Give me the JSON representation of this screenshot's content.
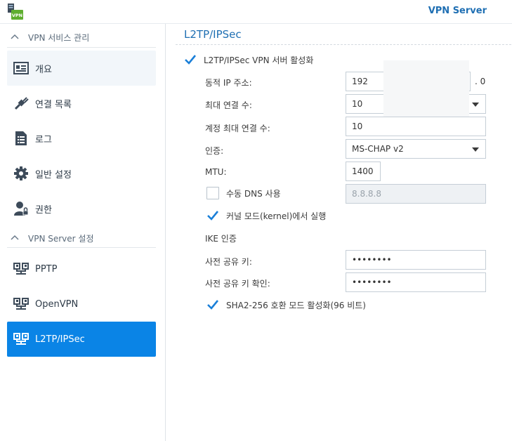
{
  "header": {
    "app_title": "VPN Server",
    "app_icon": "vpn-app-icon",
    "icon_badge": "VPN"
  },
  "sidebar": {
    "section_manage": "VPN 서비스 관리",
    "section_settings": "VPN Server 설정",
    "manage_items": [
      {
        "label": "개요",
        "icon": "overview-icon"
      },
      {
        "label": "연결 목록",
        "icon": "connection-list-icon"
      },
      {
        "label": "로그",
        "icon": "log-icon"
      },
      {
        "label": "일반 설정",
        "icon": "gear-icon"
      },
      {
        "label": "권한",
        "icon": "user-privilege-icon"
      }
    ],
    "settings_items": [
      {
        "label": "PPTP",
        "icon": "network-icon"
      },
      {
        "label": "OpenVPN",
        "icon": "network-icon"
      },
      {
        "label": "L2TP/IPSec",
        "icon": "network-icon",
        "active": true
      }
    ]
  },
  "main": {
    "title": "L2TP/IPSec",
    "enable_label": "L2TP/IPSec VPN 서버 활성화",
    "enable_checked": true,
    "dynamic_ip_label": "동적 IP 주소:",
    "dynamic_ip_value": "192",
    "dynamic_ip_suffix": ". 0",
    "max_conn_label": "최대 연결 수:",
    "max_conn_value": "10",
    "account_max_label": "계정 최대 연결 수:",
    "account_max_value": "10",
    "auth_label": "인증:",
    "auth_value": "MS-CHAP v2",
    "mtu_label": "MTU:",
    "mtu_value": "1400",
    "manual_dns_label": "수동 DNS 사용",
    "manual_dns_checked": false,
    "manual_dns_value": "8.8.8.8",
    "kernel_label": "커널 모드(kernel)에서 실행",
    "kernel_checked": true,
    "ike_label": "IKE 인증",
    "psk_label": "사전 공유 키:",
    "psk_value": "••••••••",
    "psk_confirm_label": "사전 공유 키 확인:",
    "psk_confirm_value": "••••••••",
    "sha2_label": "SHA2-256 호환 모드 활성화(96 비트)",
    "sha2_checked": true
  },
  "colors": {
    "accent": "#0a84e6",
    "title_blue": "#1f6fb3",
    "check_blue": "#1a7fd8"
  }
}
